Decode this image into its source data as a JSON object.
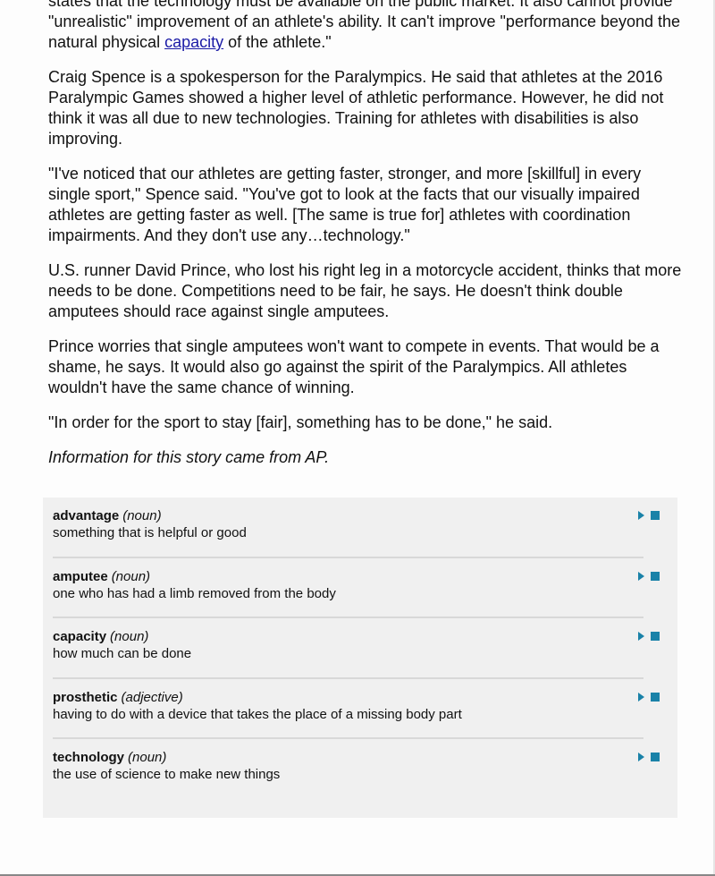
{
  "article": {
    "p1_before_link": "states that the technology must be available on the public market. It also cannot provide \"unrealistic\" improvement of an athlete's ability. It can't improve \"performance beyond the natural physical ",
    "p1_link": "capacity",
    "p1_after_link": " of the athlete.\"",
    "paragraphs": [
      "Craig Spence is a spokesperson for the Paralympics. He said that athletes at the 2016 Paralympic Games showed a higher level of athletic performance. However, he did not think it was all due to new technologies. Training for athletes with disabilities is also improving.",
      "\"I've noticed that our athletes are getting faster, stronger, and more [skillful] in every single sport,\" Spence said. \"You've got to look at the facts that our visually impaired athletes are getting faster as well. [The same is true for] athletes with coordination impairments. And they don't use any…technology.\"",
      "U.S. runner David Prince, who lost his right leg in a motorcycle accident, thinks that more needs to be done. Competitions need to be fair, he says. He doesn't think double amputees should race against single amputees.",
      "Prince worries that single amputees won't want to compete in events. That would be a shame, he says. It would also go against the spirit of the Paralympics. All athletes wouldn't have the same chance of winning.",
      "\"In order for the sport to stay [fair], something has to be done,\" he said."
    ],
    "credit": "Information for this story came from AP."
  },
  "glossary": [
    {
      "term": "advantage",
      "pos": "(noun)",
      "definition": "something that is helpful or good"
    },
    {
      "term": "amputee",
      "pos": "(noun)",
      "definition": "one who has had a limb removed from the body"
    },
    {
      "term": "capacity",
      "pos": "(noun)",
      "definition": "how much can be done"
    },
    {
      "term": "prosthetic",
      "pos": "(adjective)",
      "definition": "having to do with a device that takes the place of a missing body part"
    },
    {
      "term": "technology",
      "pos": "(noun)",
      "definition": "the use of science to make new things"
    }
  ],
  "icons": {
    "play": "play-icon",
    "stop": "stop-icon"
  },
  "colors": {
    "audio_controls": "#1a82a8",
    "link": "#1a1aa6",
    "glossary_bg": "#f0f0f0"
  }
}
